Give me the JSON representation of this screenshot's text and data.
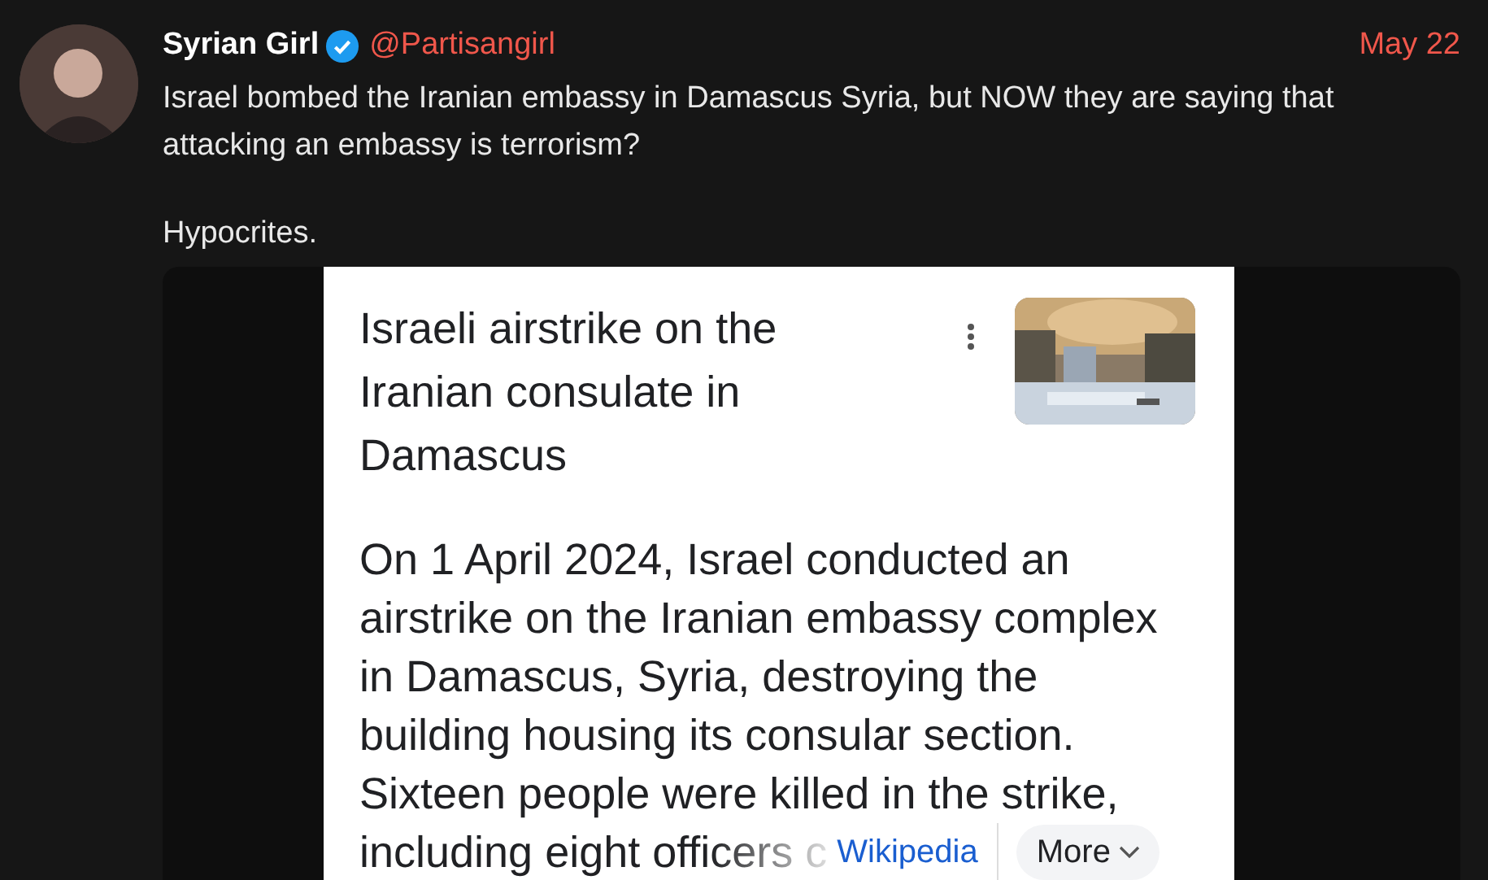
{
  "tweet": {
    "author": {
      "name": "Syrian Girl",
      "verified": true,
      "handle": "@Partisangirl"
    },
    "date": "May 22",
    "text": [
      "Israel bombed the Iranian embassy in Damascus Syria, but NOW they are saying that attacking an embassy is terrorism?",
      "Hypocrites."
    ],
    "media": {
      "kind": "screenshot",
      "title": "Israeli airstrike on the Iranian consulate in Damascus",
      "body_lines": [
        "On 1 April 2024, Israel conducted an",
        "airstrike on the Iranian embassy complex",
        "in Damascus, Syria, destroying the",
        "building housing its consular section.",
        "Sixteen people were killed in the strike,"
      ],
      "last_line": "including eight officers c",
      "source": "Wikipedia",
      "more_button": "More"
    }
  }
}
